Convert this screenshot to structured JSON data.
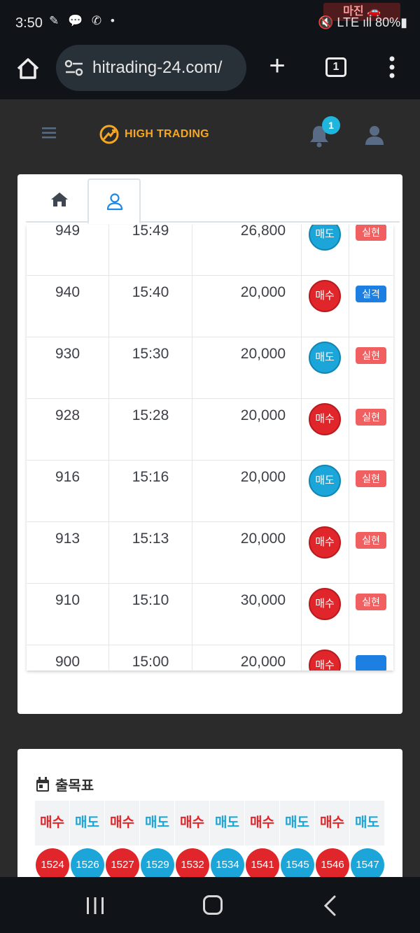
{
  "status_bar": {
    "time": "3:50",
    "notification_icons": "✎ 💬 ✆ •",
    "right": "🔇 LTE ıll 80%▮",
    "watermark": "마진 🚗"
  },
  "browser": {
    "url": "hitrading-24.com/",
    "tab_count": "1",
    "new_tab_glyph": "+"
  },
  "site": {
    "logo_text": "HIGH TRADING",
    "notification_count": "1"
  },
  "trades": [
    {
      "no": "949",
      "time": "15:49",
      "amount": "26,800",
      "side": "매도",
      "side_type": "sell",
      "result": "실현",
      "result_type": "profit"
    },
    {
      "no": "940",
      "time": "15:40",
      "amount": "20,000",
      "side": "매수",
      "side_type": "buy",
      "result": "실격",
      "result_type": "loss"
    },
    {
      "no": "930",
      "time": "15:30",
      "amount": "20,000",
      "side": "매도",
      "side_type": "sell",
      "result": "실현",
      "result_type": "profit"
    },
    {
      "no": "928",
      "time": "15:28",
      "amount": "20,000",
      "side": "매수",
      "side_type": "buy",
      "result": "실현",
      "result_type": "profit"
    },
    {
      "no": "916",
      "time": "15:16",
      "amount": "20,000",
      "side": "매도",
      "side_type": "sell",
      "result": "실현",
      "result_type": "profit"
    },
    {
      "no": "913",
      "time": "15:13",
      "amount": "20,000",
      "side": "매수",
      "side_type": "buy",
      "result": "실현",
      "result_type": "profit"
    },
    {
      "no": "910",
      "time": "15:10",
      "amount": "30,000",
      "side": "매수",
      "side_type": "buy",
      "result": "실현",
      "result_type": "profit"
    },
    {
      "no": "900",
      "time": "15:00",
      "amount": "20,000",
      "side": "매수",
      "side_type": "buy",
      "result": "",
      "result_type": "loss"
    }
  ],
  "chulmok": {
    "title": "출목표",
    "headers": [
      "매수",
      "매도",
      "매수",
      "매도",
      "매수",
      "매도",
      "매수",
      "매도",
      "매수",
      "매도"
    ],
    "values": [
      "1524",
      "1526",
      "1527",
      "1529",
      "1532",
      "1534",
      "1541",
      "1545",
      "1546",
      "1547"
    ]
  },
  "colors": {
    "buy": "#e0262a",
    "sell": "#1ba5d8",
    "profit_badge": "#f06060",
    "loss_badge": "#1e7fe3",
    "logo": "#f5a623"
  }
}
